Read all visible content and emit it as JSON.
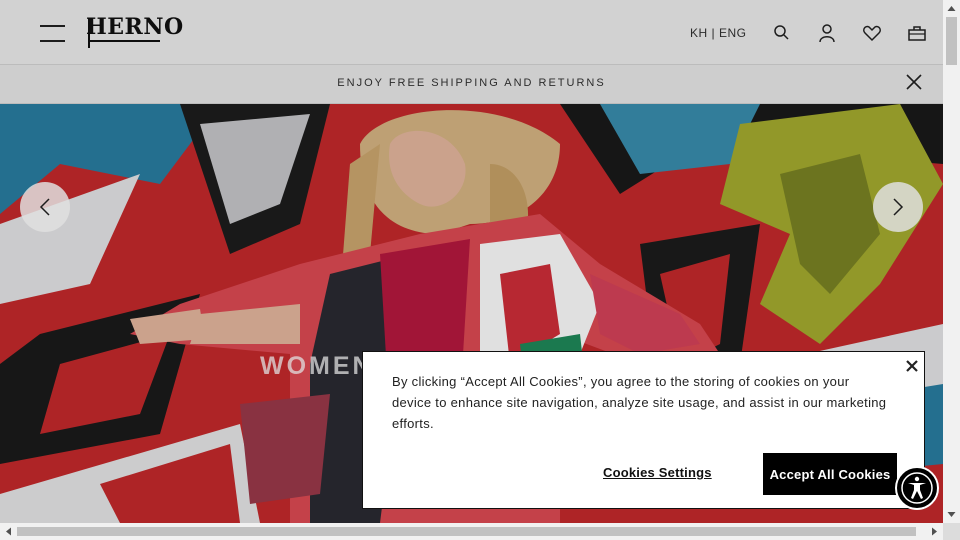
{
  "header": {
    "logo_text": "HERNO",
    "language": "KH | ENG"
  },
  "banner": {
    "text": "ENJOY FREE SHIPPING AND RETURNS"
  },
  "hero": {
    "title": "WOMEN"
  },
  "cookie": {
    "message": "By clicking “Accept All Cookies”, you agree to the storing of cookies on your device to enhance site navigation, analyze site usage, and assist in our marketing efforts.",
    "settings_label": "Cookies Settings",
    "accept_label": "Accept All Cookies"
  },
  "colors": {
    "header_bg": "#f0f0f0",
    "banner_bg": "#ebebeb",
    "mural_red": "#c62a2c",
    "button_bg": "#000000"
  },
  "icons": [
    "menu-icon",
    "search-icon",
    "account-icon",
    "heart-icon",
    "bag-icon",
    "close-icon",
    "chevron-left-icon",
    "chevron-right-icon",
    "accessibility-icon"
  ]
}
